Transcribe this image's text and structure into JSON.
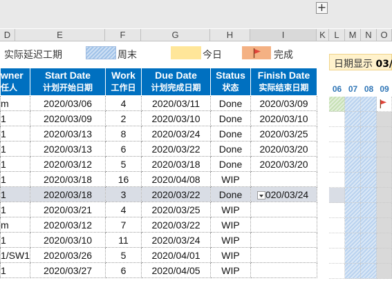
{
  "ribbon": {
    "expand_label": "+"
  },
  "columns": [
    "D",
    "E",
    "F",
    "G",
    "H",
    "I",
    "K",
    "L",
    "M",
    "N",
    "O"
  ],
  "legend": {
    "delay_label": "实际延迟工期",
    "weekend_label": "周末",
    "today_label": "今日",
    "done_label": "完成"
  },
  "timeline": {
    "label": "日期显示",
    "value": "03/"
  },
  "days": [
    "06",
    "07",
    "08",
    "09"
  ],
  "headers": {
    "owner_en": "wner",
    "owner_cn": "任人",
    "start_en": "Start Date",
    "start_cn": "计划开始日期",
    "work_en": "Work",
    "work_cn": "工作日",
    "due_en": "Due Date",
    "due_cn": "计划完成日期",
    "status_en": "Status",
    "status_cn": "状态",
    "finish_en": "Finish Date",
    "finish_cn": "实际结束日期"
  },
  "rows": [
    {
      "owner": "m",
      "start": "2020/03/06",
      "work": "4",
      "due": "2020/03/11",
      "status": "Done",
      "finish": "2020/03/09"
    },
    {
      "owner": "1",
      "start": "2020/03/09",
      "work": "2",
      "due": "2020/03/10",
      "status": "Done",
      "finish": "2020/03/10"
    },
    {
      "owner": "1",
      "start": "2020/03/13",
      "work": "8",
      "due": "2020/03/24",
      "status": "Done",
      "finish": "2020/03/25"
    },
    {
      "owner": "1",
      "start": "2020/03/13",
      "work": "6",
      "due": "2020/03/22",
      "status": "Done",
      "finish": "2020/03/20"
    },
    {
      "owner": "1",
      "start": "2020/03/12",
      "work": "5",
      "due": "2020/03/18",
      "status": "Done",
      "finish": "2020/03/20"
    },
    {
      "owner": "1",
      "start": "2020/03/18",
      "work": "16",
      "due": "2020/04/08",
      "status": "WIP",
      "finish": ""
    },
    {
      "owner": "1",
      "start": "2020/03/18",
      "work": "3",
      "due": "2020/03/22",
      "status": "Done",
      "finish": "020/03/24"
    },
    {
      "owner": "1",
      "start": "2020/03/21",
      "work": "4",
      "due": "2020/03/25",
      "status": "WIP",
      "finish": ""
    },
    {
      "owner": "m",
      "start": "2020/03/12",
      "work": "7",
      "due": "2020/03/22",
      "status": "WIP",
      "finish": ""
    },
    {
      "owner": "1",
      "start": "2020/03/10",
      "work": "11",
      "due": "2020/03/24",
      "status": "WIP",
      "finish": ""
    },
    {
      "owner": "1/SW1",
      "start": "2020/03/26",
      "work": "5",
      "due": "2020/04/01",
      "status": "WIP",
      "finish": ""
    },
    {
      "owner": "1",
      "start": "2020/03/27",
      "work": "6",
      "due": "2020/04/05",
      "status": "WIP",
      "finish": ""
    }
  ],
  "colors": {
    "header_blue": "#0070c0",
    "weekend": "#9fc2e8",
    "today": "#ffe699",
    "done": "#f4b183",
    "selected_row": "#d9dde5"
  }
}
